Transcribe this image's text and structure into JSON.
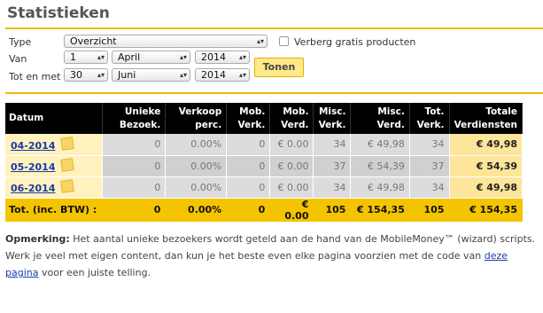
{
  "title": "Statistieken",
  "filters": {
    "type_label": "Type",
    "type_value": "Overzicht",
    "hide_free_label": "Verberg gratis producten",
    "from_label": "Van",
    "from_day": "1",
    "from_month": "April",
    "from_year": "2014",
    "to_label": "Tot en met",
    "to_day": "30",
    "to_month": "Juni",
    "to_year": "2014",
    "submit_label": "Tonen"
  },
  "table": {
    "headers": [
      "Datum",
      "Unieke Bezoek.",
      "Verkoop perc.",
      "Mob. Verk.",
      "Mob. Verd.",
      "Misc. Verk.",
      "Misc. Verd.",
      "Tot. Verk.",
      "Totale Verdiensten"
    ],
    "rows": [
      {
        "date": "04-2014",
        "visitors": "0",
        "perc": "0.00%",
        "mob_sales": "0",
        "mob_earn": "€ 0.00",
        "misc_sales": "34",
        "misc_earn": "€ 49,98",
        "tot_sales": "34",
        "total": "€ 49,98"
      },
      {
        "date": "05-2014",
        "visitors": "0",
        "perc": "0.00%",
        "mob_sales": "0",
        "mob_earn": "€ 0.00",
        "misc_sales": "37",
        "misc_earn": "€ 54,39",
        "tot_sales": "37",
        "total": "€ 54,39"
      },
      {
        "date": "06-2014",
        "visitors": "0",
        "perc": "0.00%",
        "mob_sales": "0",
        "mob_earn": "€ 0.00",
        "misc_sales": "34",
        "misc_earn": "€ 49,98",
        "tot_sales": "34",
        "total": "€ 49,98"
      }
    ],
    "totals": {
      "label": "Tot. (inc. BTW) :",
      "visitors": "0",
      "perc": "0.00%",
      "mob_sales": "0",
      "mob_earn": "€ 0.00",
      "misc_sales": "105",
      "misc_earn": "€ 154,35",
      "tot_sales": "105",
      "total": "€ 154,35"
    }
  },
  "remark": {
    "bold": "Opmerking:",
    "text1": " Het aantal unieke bezoekers wordt geteld aan de hand van de MobileMoney™ (wizard) scripts. Werk je veel met eigen content, dan kun je het beste even elke pagina voorzien met de code van ",
    "link": "deze pagina",
    "text2": " voor een juiste telling."
  },
  "colors": {
    "accent": "#f2b705",
    "header_bg": "#000000",
    "total_row": "#f5c400"
  }
}
